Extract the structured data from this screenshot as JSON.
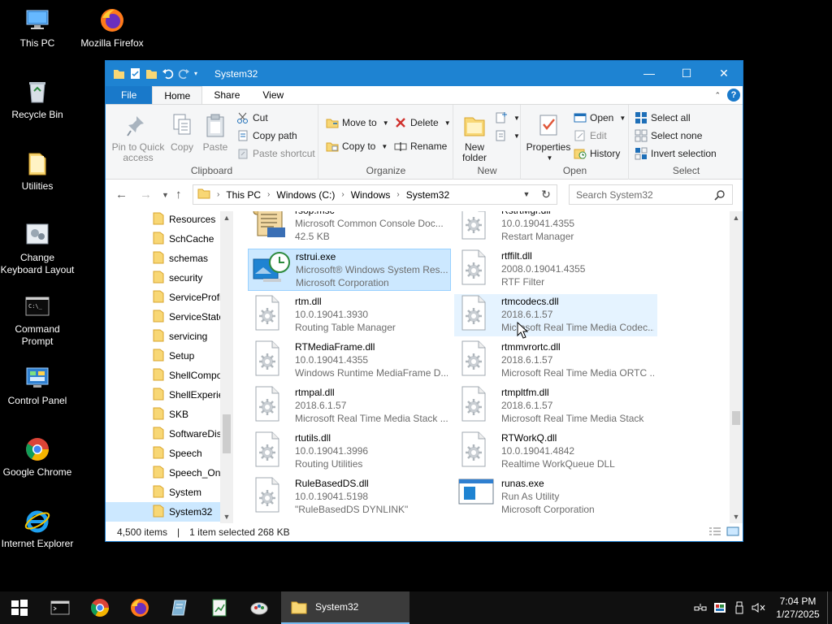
{
  "desktop": {
    "icons": [
      {
        "label": "This PC"
      },
      {
        "label": "Mozilla Firefox"
      },
      {
        "label": "Recycle Bin"
      },
      {
        "label": "Utilities"
      },
      {
        "label": "Change Keyboard Layout"
      },
      {
        "label": "Command Prompt"
      },
      {
        "label": "Control Panel"
      },
      {
        "label": "Google Chrome"
      },
      {
        "label": "Internet Explorer"
      }
    ]
  },
  "window": {
    "title": "System32",
    "controls": {
      "minimize": "—",
      "maximize": "☐",
      "close": "✕"
    }
  },
  "tabs": [
    "File",
    "Home",
    "Share",
    "View"
  ],
  "help_label": "?",
  "ribbon": {
    "clipboard": {
      "label": "Clipboard",
      "pin": "Pin to Quick access",
      "copy": "Copy",
      "paste": "Paste",
      "cut": "Cut",
      "copy_path": "Copy path",
      "paste_shortcut": "Paste shortcut"
    },
    "organize": {
      "label": "Organize",
      "move_to": "Move to",
      "copy_to": "Copy to",
      "delete": "Delete",
      "rename": "Rename"
    },
    "new": {
      "label": "New",
      "new_folder": "New folder"
    },
    "open": {
      "label": "Open",
      "properties": "Properties",
      "open": "Open",
      "edit": "Edit",
      "history": "History"
    },
    "select": {
      "label": "Select",
      "select_all": "Select all",
      "select_none": "Select none",
      "invert": "Invert selection"
    }
  },
  "address": {
    "crumbs": [
      "This PC",
      "Windows (C:)",
      "Windows",
      "System32"
    ],
    "search_placeholder": "Search System32"
  },
  "nav_pane": {
    "items": [
      {
        "label": "Resources"
      },
      {
        "label": "SchCache"
      },
      {
        "label": "schemas"
      },
      {
        "label": "security"
      },
      {
        "label": "ServiceProfi"
      },
      {
        "label": "ServiceState"
      },
      {
        "label": "servicing"
      },
      {
        "label": "Setup"
      },
      {
        "label": "ShellCompo"
      },
      {
        "label": "ShellExperie"
      },
      {
        "label": "SKB"
      },
      {
        "label": "SoftwareDis"
      },
      {
        "label": "Speech"
      },
      {
        "label": "Speech_One"
      },
      {
        "label": "System"
      },
      {
        "label": "System32"
      }
    ],
    "selected": "System32"
  },
  "files": [
    {
      "name": "rsop.msc",
      "line2": "Microsoft Common Console Doc...",
      "line3": "42.5 KB",
      "icon": "msc-scroll-icon"
    },
    {
      "name": "RstrtMgr.dll",
      "line2": "10.0.19041.4355",
      "line3": "Restart Manager",
      "icon": "dll-gear-icon"
    },
    {
      "name": "rstrui.exe",
      "line2": "Microsoft® Windows System Res...",
      "line3": "Microsoft Corporation",
      "icon": "system-restore-icon"
    },
    {
      "name": "rtffilt.dll",
      "line2": "2008.0.19041.4355",
      "line3": "RTF Filter",
      "icon": "dll-gear-icon"
    },
    {
      "name": "rtm.dll",
      "line2": "10.0.19041.3930",
      "line3": "Routing Table Manager",
      "icon": "dll-gear-icon"
    },
    {
      "name": "rtmcodecs.dll",
      "line2": "2018.6.1.57",
      "line3": "Microsoft Real Time Media Codec...",
      "icon": "dll-gear-icon"
    },
    {
      "name": "RTMediaFrame.dll",
      "line2": "10.0.19041.4355",
      "line3": "Windows Runtime MediaFrame D...",
      "icon": "dll-gear-icon"
    },
    {
      "name": "rtmmvrortc.dll",
      "line2": "2018.6.1.57",
      "line3": "Microsoft Real Time Media ORTC ...",
      "icon": "dll-gear-icon"
    },
    {
      "name": "rtmpal.dll",
      "line2": "2018.6.1.57",
      "line3": "Microsoft Real Time Media Stack ...",
      "icon": "dll-gear-icon"
    },
    {
      "name": "rtmpltfm.dll",
      "line2": "2018.6.1.57",
      "line3": "Microsoft Real Time Media Stack",
      "icon": "dll-gear-icon"
    },
    {
      "name": "rtutils.dll",
      "line2": "10.0.19041.3996",
      "line3": "Routing Utilities",
      "icon": "dll-gear-icon"
    },
    {
      "name": "RTWorkQ.dll",
      "line2": "10.0.19041.4842",
      "line3": "Realtime WorkQueue DLL",
      "icon": "dll-gear-icon"
    },
    {
      "name": "RuleBasedDS.dll",
      "line2": "10.0.19041.5198",
      "line3": "\"RuleBasedDS DYNLINK\"",
      "icon": "dll-gear-icon"
    },
    {
      "name": "runas.exe",
      "line2": "Run As Utility",
      "line3": "Microsoft Corporation",
      "icon": "exe-window-icon"
    }
  ],
  "selected_file": "rstrui.exe",
  "hovered_file": "rtmcodecs.dll",
  "status": {
    "count": "4,500 items",
    "selection": "1 item selected  268 KB"
  },
  "taskbar": {
    "active_window": "System32",
    "time": "7:04 PM",
    "date": "1/27/2025"
  },
  "colors": {
    "accent": "#1e83d2",
    "selection": "#cce8ff",
    "taskbar": "#101010",
    "desktop": "#000000"
  }
}
